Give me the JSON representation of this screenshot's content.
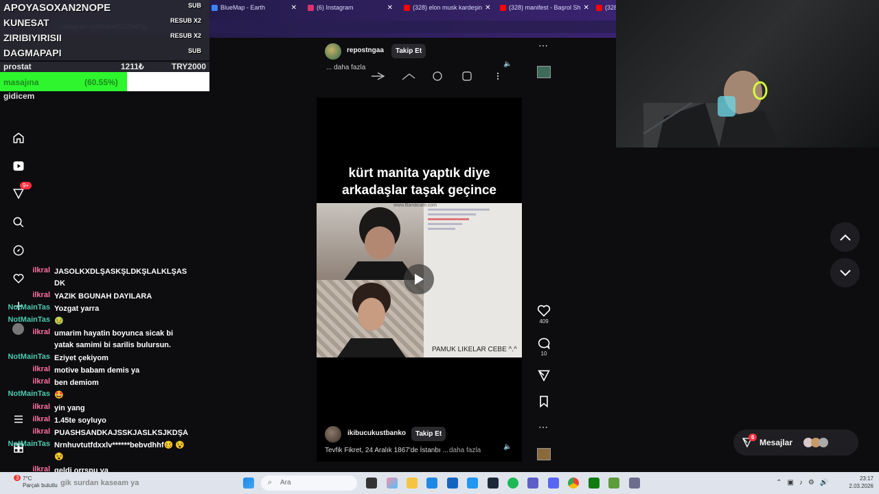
{
  "browser": {
    "tabs": [
      {
        "label": "BlueMap - Earth",
        "color": "#3b82f6"
      },
      {
        "label": "(6) Instagram",
        "color": "#e1306c"
      },
      {
        "label": "(328) elon musk kardeşin",
        "color": "#ff0000"
      },
      {
        "label": "(328) manifest - Başrol Sh",
        "color": "#ff0000"
      },
      {
        "label": "(328",
        "color": "#ff0000"
      }
    ],
    "tab_close": "✕",
    "url": "instagram.com/reels/DVZH4Rjy..."
  },
  "overlay": {
    "rows": [
      {
        "name": "APOYASOXAN2NOPE",
        "tag": "SUB"
      },
      {
        "name": "KUNESAT",
        "tag": "RESUB X2"
      },
      {
        "name": "ZIRIBIYIRISII",
        "tag": "RESUB X2"
      },
      {
        "name": "DAGMAPAPI",
        "tag": "SUB"
      }
    ],
    "goal": {
      "label": "prostat",
      "amount": "1211₺",
      "target": "TRY2000"
    },
    "bar": {
      "label": "masajına",
      "percent_text": "(60.55%)",
      "fraction": 0.6055
    },
    "bottom_label": "gidicem"
  },
  "sidebar": {
    "notif_badge": "9+"
  },
  "chat": {
    "messages": [
      {
        "user": "ilkral",
        "text": "JASOLKXDLŞASKŞLDKŞLALKLŞAS DK",
        "user_color": "#ff6fa0"
      },
      {
        "user": "ilkral",
        "text": "YAZIK BGUNAH DAYILARA",
        "user_color": "#ff6fa0"
      },
      {
        "user": "NotMainTas",
        "text": "Yozgat yarra",
        "user_color": "#4ec9b0"
      },
      {
        "user": "NotMainTas",
        "text": "🤢",
        "user_color": "#4ec9b0"
      },
      {
        "user": "ilkral",
        "text": "umarim hayatin boyunca sicak bi yatak samimi bi sarilis bulursun.",
        "user_color": "#ff6fa0"
      },
      {
        "user": "NotMainTas",
        "text": "Eziyet çekiyom",
        "user_color": "#4ec9b0"
      },
      {
        "user": "ilkral",
        "text": "motive babam demis ya",
        "user_color": "#ff6fa0"
      },
      {
        "user": "ilkral",
        "text": "ben demiom",
        "user_color": "#ff6fa0"
      },
      {
        "user": "NotMainTas",
        "text": "🤩",
        "user_color": "#4ec9b0"
      },
      {
        "user": "ilkral",
        "text": "yin yang",
        "user_color": "#ff6fa0"
      },
      {
        "user": "ilkral",
        "text": "1.45te soyluyo",
        "user_color": "#ff6fa0"
      },
      {
        "user": "ilkral",
        "text": "PUASHSANDKAJSSKJASLKSJKDŞA",
        "user_color": "#ff6fa0"
      },
      {
        "user": "NotMainTas",
        "text": "Nrnhuvtutfdxxlv******bebvdhhf🥴 😵😵",
        "user_color": "#4ec9b0"
      },
      {
        "user": "ilkral",
        "text": "geldi orrspu ya",
        "user_color": "#ff6fa0"
      }
    ]
  },
  "post_top": {
    "username": "repostngaa",
    "follow": "Takip Et",
    "more": "... daha fazla"
  },
  "video": {
    "caption_line1": "kürt manita yaptık diye",
    "caption_line2": "arkadaşlar taşak geçince",
    "watermark": "www.Bandicam.com",
    "bottom_text": "PAMUK LIKELAR CEBE ^.^"
  },
  "actions": {
    "likes": "409",
    "comments": "10"
  },
  "post_bottom": {
    "username": "ikibucukustbanko",
    "follow": "Takip Et",
    "caption": "Tevfik Fikret, 24 Aralık 1867'de İstanbı ...",
    "more": "daha fazla"
  },
  "messages": {
    "label": "Mesajlar",
    "badge": "6"
  },
  "taskbar": {
    "weather_temp": "7°C",
    "weather_desc": "Parçalı bulutlu",
    "search": "Ara",
    "time": "23:17",
    "date": "2.03.2026",
    "notification_badge": "3",
    "chat_overflow_text": "gik surdan kaseam ya"
  }
}
